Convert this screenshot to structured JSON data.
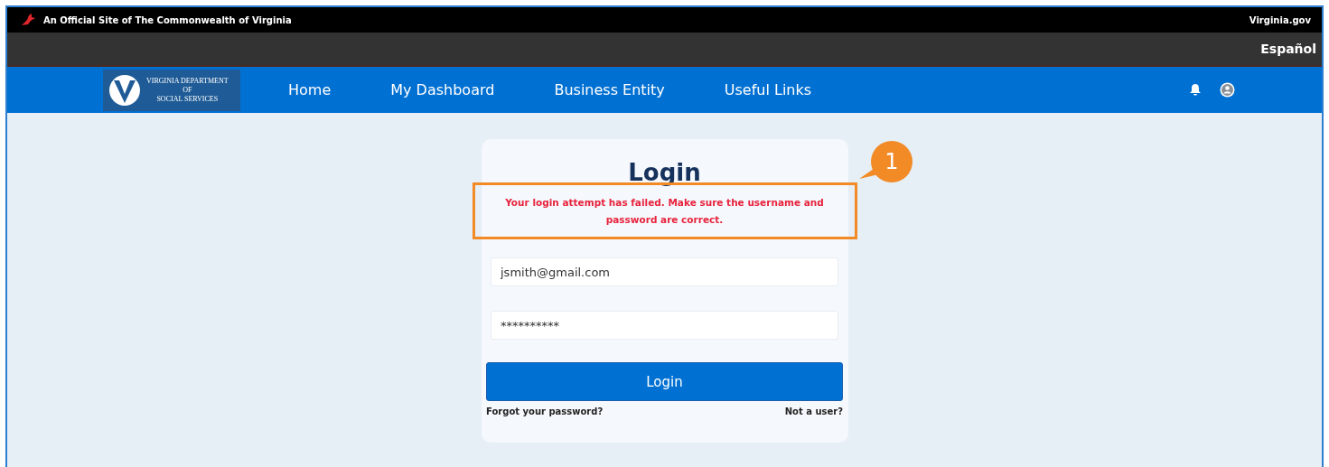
{
  "top_bar": {
    "official_text": "An Official Site of The Commonwealth of Virginia",
    "link": "Virginia.gov"
  },
  "language_bar": {
    "language_link": "Español"
  },
  "nav": {
    "logo_lines": [
      "VIRGINIA DEPARTMENT",
      "OF",
      "SOCIAL SERVICES"
    ],
    "items": [
      {
        "label": "Home"
      },
      {
        "label": "My Dashboard"
      },
      {
        "label": "Business Entity"
      },
      {
        "label": "Useful Links"
      }
    ]
  },
  "login_card": {
    "title": "Login",
    "error": "Your login attempt has failed. Make sure the username and password are correct.",
    "username": {
      "value": "jsmith@gmail.com"
    },
    "password": {
      "value": "**********"
    },
    "button": "Login",
    "forgot_link": "Forgot your password?",
    "register_link": "Not a user?"
  },
  "callout": {
    "number": "1"
  }
}
